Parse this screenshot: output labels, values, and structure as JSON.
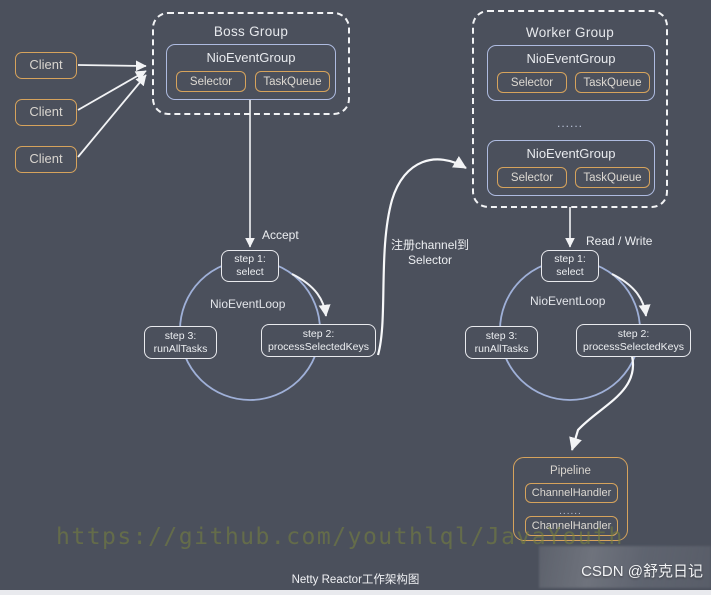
{
  "diagram": {
    "caption": "Netty Reactor工作架构图",
    "background_color": "#4b505c",
    "accent_orange": "#d6a35c",
    "accent_blue": "#aebbe0",
    "line_color": "#f2f3f5"
  },
  "clients": [
    {
      "label": "Client"
    },
    {
      "label": "Client"
    },
    {
      "label": "Client"
    }
  ],
  "boss_group": {
    "title": "Boss Group",
    "event_group": {
      "title": "NioEventGroup",
      "selector_label": "Selector",
      "taskqueue_label": "TaskQueue"
    }
  },
  "worker_group": {
    "title": "Worker Group",
    "ellipsis": "......",
    "event_groups": [
      {
        "title": "NioEventGroup",
        "selector_label": "Selector",
        "taskqueue_label": "TaskQueue"
      },
      {
        "title": "NioEventGroup",
        "selector_label": "Selector",
        "taskqueue_label": "TaskQueue"
      }
    ]
  },
  "boss_loop": {
    "name": "NioEventLoop",
    "inbound_label": "Accept",
    "steps": [
      {
        "line1": "step 1:",
        "line2": "select"
      },
      {
        "line1": "step 2:",
        "line2": "processSelectedKeys"
      },
      {
        "line1": "step 3:",
        "line2": "runAllTasks"
      }
    ]
  },
  "worker_loop": {
    "name": "NioEventLoop",
    "inbound_label": "Read / Write",
    "steps": [
      {
        "line1": "step 1:",
        "line2": "select"
      },
      {
        "line1": "step 2:",
        "line2": "processSelectedKeys"
      },
      {
        "line1": "step 3:",
        "line2": "runAllTasks"
      }
    ]
  },
  "register_flow": {
    "line1": "注册channel到",
    "line2": "Selector"
  },
  "pipeline": {
    "title": "Pipeline",
    "ellipsis": "......",
    "handlers": [
      {
        "label": "ChannelHandler"
      },
      {
        "label": "ChannelHandler"
      }
    ]
  },
  "watermarks": {
    "url": "https://github.com/youthlql/JavaYouth",
    "credit": "CSDN @舒克日记"
  }
}
